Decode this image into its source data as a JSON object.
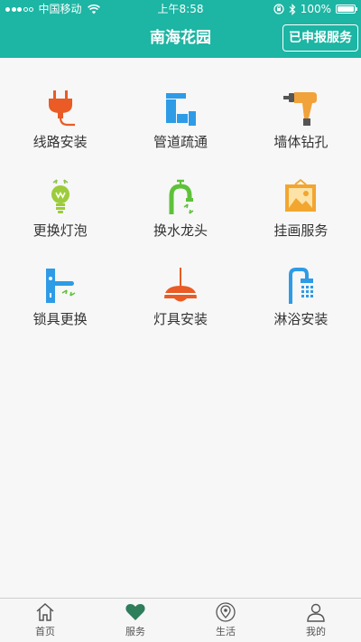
{
  "status_bar": {
    "carrier": "中国移动",
    "time": "上午8:58",
    "battery": "100%",
    "battery_level": 1.0,
    "signal_bars_filled": 3,
    "signal_bars_total": 5
  },
  "header": {
    "title": "南海花园",
    "action_label": "已申报服务",
    "background_color": "#1db5a3"
  },
  "services": [
    {
      "label": "线路安装",
      "icon": "plug-icon"
    },
    {
      "label": "管道疏通",
      "icon": "pipe-icon"
    },
    {
      "label": "墙体钻孔",
      "icon": "drill-icon"
    },
    {
      "label": "更换灯泡",
      "icon": "light-bulb-icon"
    },
    {
      "label": "换水龙头",
      "icon": "faucet-icon"
    },
    {
      "label": "挂画服务",
      "icon": "picture-frame-icon"
    },
    {
      "label": "锁具更换",
      "icon": "door-lock-icon"
    },
    {
      "label": "灯具安装",
      "icon": "lamp-icon"
    },
    {
      "label": "淋浴安装",
      "icon": "shower-icon"
    }
  ],
  "tab_bar": {
    "active": "服务",
    "items": [
      {
        "label": "首页",
        "icon": "home-icon"
      },
      {
        "label": "服务",
        "icon": "heart-icon"
      },
      {
        "label": "生活",
        "icon": "location-pin-icon"
      },
      {
        "label": "我的",
        "icon": "user-icon"
      }
    ]
  }
}
